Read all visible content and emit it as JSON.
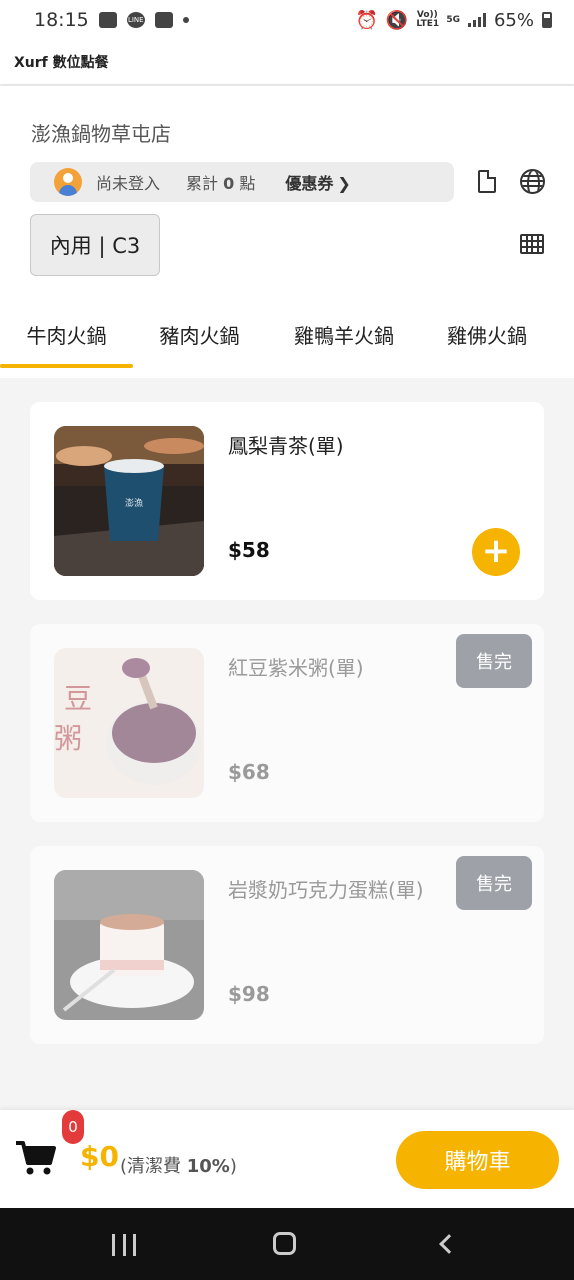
{
  "status_bar": {
    "time": "18:15",
    "battery": "65%",
    "volte": "Vo)) LTE1",
    "net": "5G"
  },
  "app": {
    "title": "Xurf 數位點餐"
  },
  "store": {
    "name": "澎漁鍋物草屯店",
    "member_status": "尚未登入",
    "points_label": "累計",
    "points_value": "0",
    "points_unit": "點",
    "coupon_label": "優惠券",
    "dine_mode": "內用 | C3"
  },
  "tabs": [
    {
      "label": "牛肉火鍋",
      "active": true
    },
    {
      "label": "豬肉火鍋",
      "active": false
    },
    {
      "label": "雞鴨羊火鍋",
      "active": false
    },
    {
      "label": "雞佛火鍋",
      "active": false
    }
  ],
  "items": [
    {
      "name": "鳳梨青茶(單)",
      "price": "$58",
      "sold_out": false
    },
    {
      "name": "紅豆紫米粥(單)",
      "price": "$68",
      "sold_out": true,
      "badge": "售完"
    },
    {
      "name": "岩漿奶巧克力蛋糕(單)",
      "price": "$98",
      "sold_out": true,
      "badge": "售完"
    }
  ],
  "cart": {
    "count": "0",
    "total": "$0",
    "fee_prefix": "(清潔費 ",
    "fee_value": "10%",
    "fee_suffix": ")",
    "button_label": "購物車"
  },
  "colors": {
    "accent": "#f6b400",
    "badge": "#e33b3b",
    "soldout": "#9ea2a8"
  }
}
